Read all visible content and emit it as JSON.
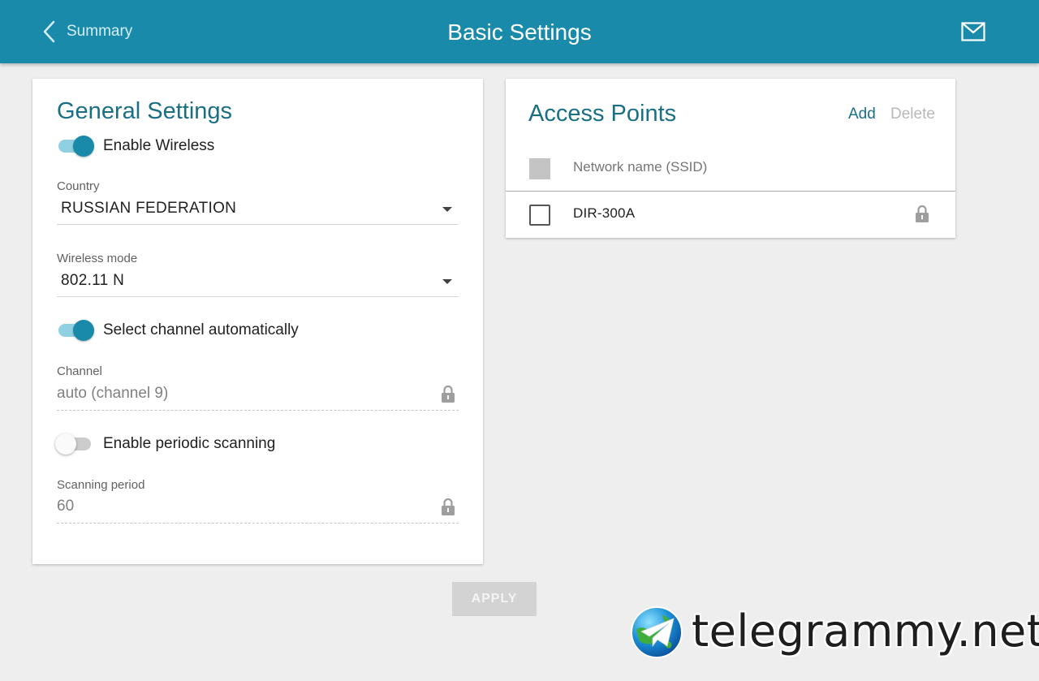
{
  "header": {
    "back_label": "Summary",
    "title": "Basic Settings",
    "icons": {
      "back": "chevron-left-icon",
      "mail": "mail-icon"
    }
  },
  "general": {
    "title": "General Settings",
    "enable_wireless": {
      "label": "Enable Wireless",
      "on": true
    },
    "country": {
      "label": "Country",
      "value": "RUSSIAN FEDERATION"
    },
    "wireless_mode": {
      "label": "Wireless mode",
      "value": "802.11 N"
    },
    "auto_channel": {
      "label": "Select channel automatically",
      "on": true
    },
    "channel": {
      "label": "Channel",
      "value": "auto (channel 9)"
    },
    "periodic_scan": {
      "label": "Enable periodic scanning",
      "on": false
    },
    "scan_period": {
      "label": "Scanning period",
      "value": "60"
    }
  },
  "access_points": {
    "title": "Access Points",
    "add_label": "Add",
    "delete_label": "Delete",
    "column_header": "Network name (SSID)",
    "rows": [
      {
        "ssid": "DIR-300A",
        "locked": true
      }
    ]
  },
  "apply_label": "APPLY",
  "watermark": {
    "text": "telegrammy.net"
  },
  "colors": {
    "header_bg": "#1a8aaa",
    "accent": "#1a6f85",
    "page_bg": "#eeeeee",
    "disabled_button": "#d3d3d3"
  }
}
